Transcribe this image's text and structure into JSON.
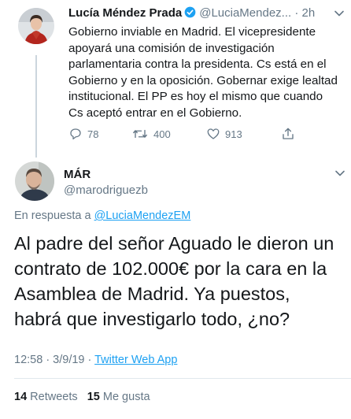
{
  "tweet1": {
    "name": "Lucía Méndez Prada",
    "handle": "@LuciaMendez...",
    "time": "· 2h",
    "text": "Gobierno inviable en Madrid. El vicepresidente apoyará una comisión de investigación parlamentaria contra la presidenta. Cs está en el Gobierno y en la oposición. Gobernar exige lealtad institucional. El PP es hoy el mismo que cuando Cs aceptó entrar en el Gobierno.",
    "replies": "78",
    "retweets": "400",
    "likes": "913"
  },
  "tweet2": {
    "name": "MÁR",
    "handle": "@marodriguezb",
    "reply_prefix": "En respuesta a",
    "reply_to": "@LuciaMendezEM",
    "text": "Al padre del señor Aguado le dieron un contrato de 102.000€ por la cara en la Asamblea de Madrid. Ya puestos, habrá que investigarlo todo, ¿no?",
    "timestamp": "12:58 · 3/9/19 ·",
    "app": "Twitter Web App",
    "retweets_count": "14",
    "retweets_label": "Retweets",
    "likes_count": "15",
    "likes_label": "Me gusta"
  },
  "icons": {
    "verified": "verified-badge-icon",
    "chevron": "chevron-down-icon",
    "reply": "reply-icon",
    "retweet": "retweet-icon",
    "like": "heart-icon",
    "share": "share-icon"
  },
  "colors": {
    "accent": "#1da1f2",
    "muted": "#657786",
    "text": "#14171a"
  }
}
